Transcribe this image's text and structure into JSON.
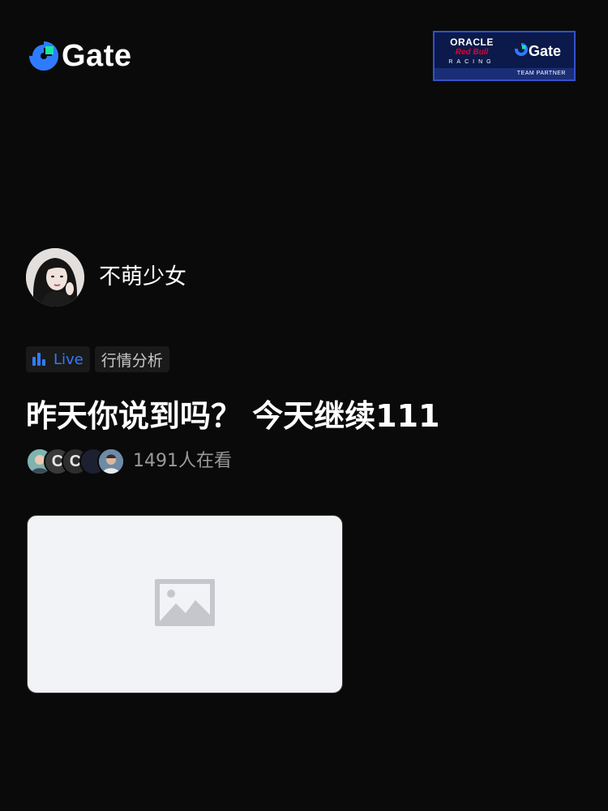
{
  "header": {
    "logo_text": "Gate",
    "logo_icon": "gate-logo-icon",
    "partner": {
      "oracle": "ORACLE",
      "redbull": "Red Bull",
      "racing": "RACING",
      "gate": "Gate",
      "tag": "TEAM PARTNER"
    }
  },
  "host": {
    "name": "不萌少女",
    "avatar_icon": "host-avatar"
  },
  "tags": {
    "live_label": "Live",
    "topic_label": "行情分析"
  },
  "stream": {
    "title": "昨天你说到吗？ 今天继续111"
  },
  "viewers": {
    "count_text": "1491人在看"
  },
  "cover": {
    "icon": "image-placeholder-icon"
  },
  "colors": {
    "background": "#0a0a0a",
    "accent_blue": "#2f7bff",
    "logo_green": "#17e6a1",
    "partner_navy": "#0b1a4a"
  }
}
